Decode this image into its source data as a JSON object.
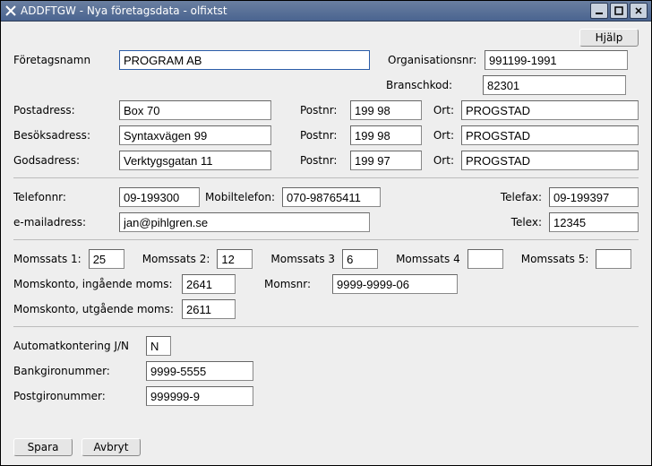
{
  "window": {
    "title": "ADDFTGW - Nya företagsdata - olfixtst",
    "help_button": "Hjälp"
  },
  "labels": {
    "foretagsnamn": "Företagsnamn",
    "organisationsnr": "Organisationsnr:",
    "branschkod": "Branschkod:",
    "postadress": "Postadress:",
    "besoksadress": "Besöksadress:",
    "godsadress": "Godsadress:",
    "postnr": "Postnr:",
    "ort": "Ort:",
    "telefonnr": "Telefonnr:",
    "mobiltelefon": "Mobiltelefon:",
    "telefax": "Telefax:",
    "email": "e-mailadress:",
    "telex": "Telex:",
    "momssats1": "Momssats 1:",
    "momssats2": "Momssats 2:",
    "momssats3": "Momssats 3",
    "momssats4": "Momssats 4",
    "momssats5": "Momssats 5:",
    "momskonto_in": "Momskonto, ingående moms:",
    "momskonto_ut": "Momskonto, utgående moms:",
    "momsnr": "Momsnr:",
    "automatkontering": "Automatkontering J/N",
    "bankgiro": "Bankgironummer:",
    "postgiro": "Postgironummer:",
    "spara": "Spara",
    "avbryt": "Avbryt"
  },
  "values": {
    "foretagsnamn": "PROGRAM AB",
    "organisationsnr": "991199-1991",
    "branschkod": "82301",
    "post_adr": "Box 70",
    "post_nr": "199 98",
    "post_ort": "PROGSTAD",
    "besok_adr": "Syntaxvägen 99",
    "besok_nr": "199 98",
    "besok_ort": "PROGSTAD",
    "gods_adr": "Verktygsgatan 11",
    "gods_nr": "199 97",
    "gods_ort": "PROGSTAD",
    "telefon": "09-199300",
    "mobil": "070-98765411",
    "telefax": "09-199397",
    "email": "jan@pihlgren.se",
    "telex": "12345",
    "momssats1": "25",
    "momssats2": "12",
    "momssats3": "6",
    "momssats4": "",
    "momssats5": "",
    "momskonto_in": "2641",
    "momskonto_ut": "2611",
    "momsnr": "9999-9999-06",
    "automatkontering": "N",
    "bankgiro": "9999-5555",
    "postgiro": "999999-9"
  }
}
